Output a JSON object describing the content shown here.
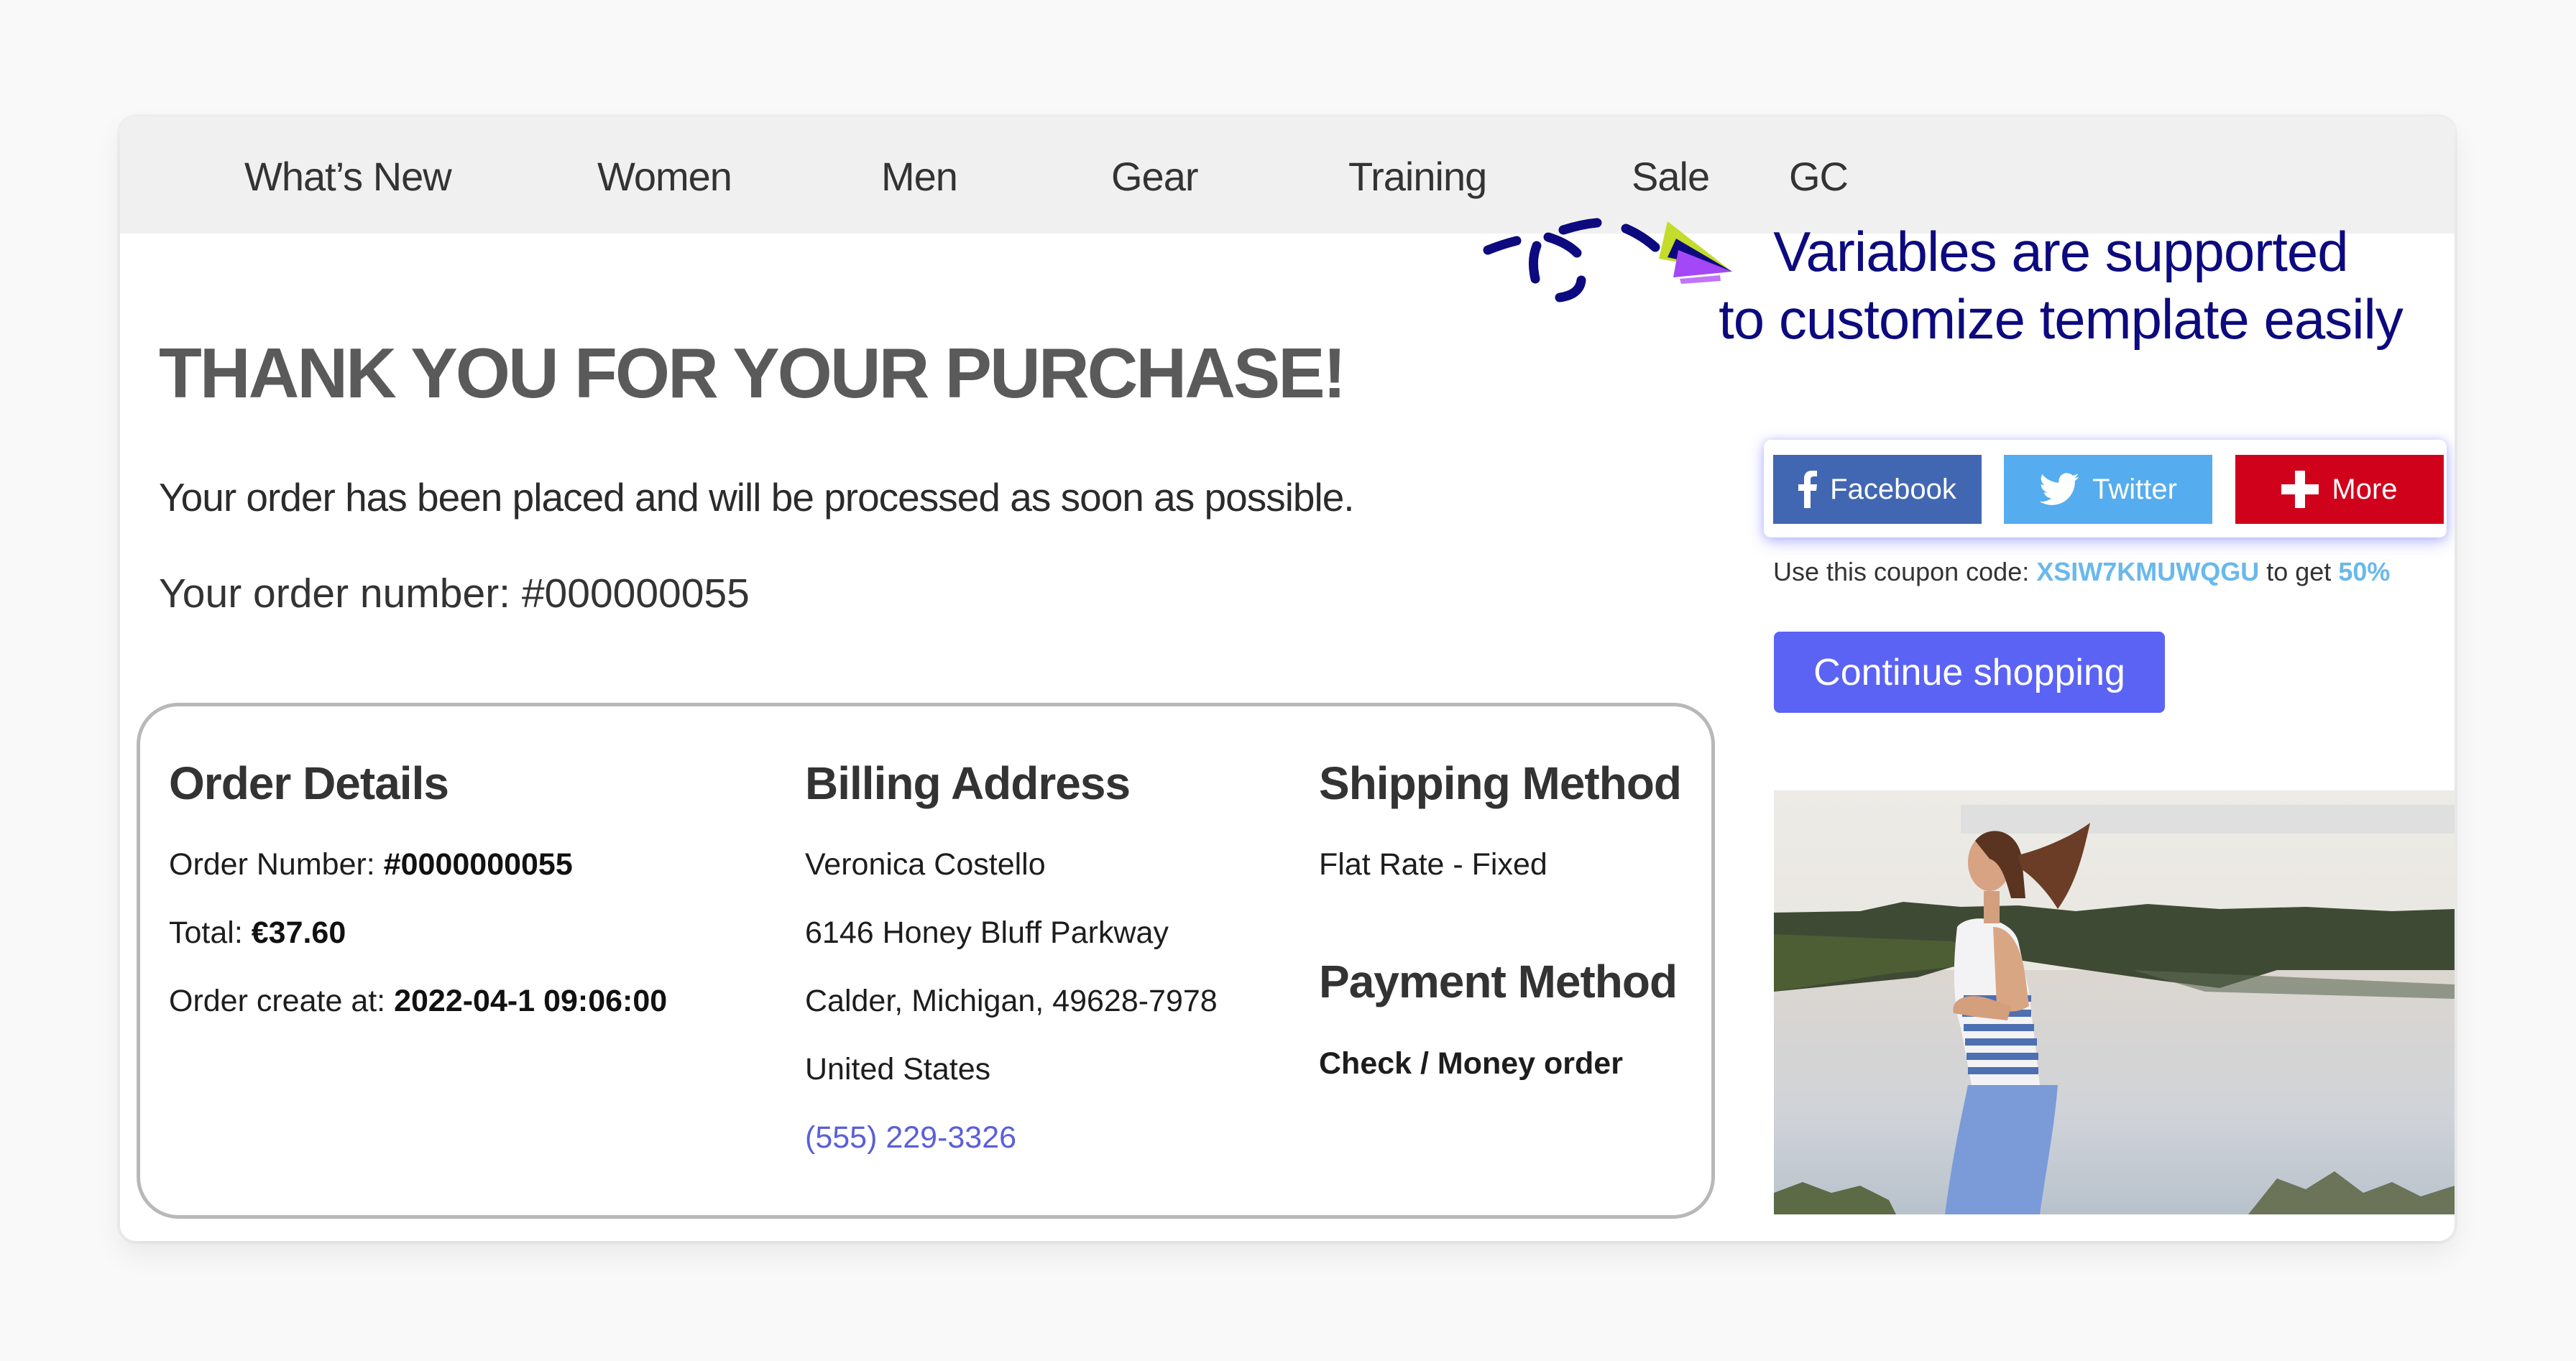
{
  "nav": {
    "items": [
      {
        "label": "What’s New"
      },
      {
        "label": "Women"
      },
      {
        "label": "Men"
      },
      {
        "label": "Gear"
      },
      {
        "label": "Training"
      },
      {
        "label": "Sale"
      },
      {
        "label": "GC"
      }
    ]
  },
  "main": {
    "title": "THANK YOU FOR YOUR PURCHASE!",
    "subtitle": "Your order has been placed and will be processed as soon as possible.",
    "order_number_line": "Your order number: #000000055"
  },
  "order_details": {
    "heading": "Order Details",
    "order_number_label": "Order Number: ",
    "order_number_value": "#0000000055",
    "total_label": "Total: ",
    "total_value": "€37.60",
    "created_label": "Order create at: ",
    "created_value": "2022-04-1 09:06:00"
  },
  "billing_address": {
    "heading": "Billing Address",
    "name": "Veronica Costello",
    "street": "6146 Honey Bluff Parkway",
    "city_line": "Calder, Michigan, 49628-7978",
    "country": "United States",
    "phone": "(555) 229-3326"
  },
  "shipping_method": {
    "heading": "Shipping Method",
    "value": "Flat Rate - Fixed"
  },
  "payment_method": {
    "heading": "Payment Method",
    "value": "Check / Money order"
  },
  "annotation": {
    "line1": "Variables are supported",
    "line2": "to customize template easily"
  },
  "social": {
    "facebook_label": "Facebook",
    "twitter_label": "Twitter",
    "more_label": "More",
    "icons": {
      "facebook": "facebook-icon",
      "twitter": "twitter-bird-icon",
      "more": "plus-icon"
    },
    "colors": {
      "facebook": "#4267b2",
      "twitter": "#55acee",
      "more": "#d0021b"
    }
  },
  "coupon": {
    "prefix": "Use this coupon code: ",
    "code": "XSIW7KMUWQGU",
    "middle": " to get ",
    "discount": "50%"
  },
  "continue_button": {
    "label": "Continue shopping",
    "color": "#5b63f5"
  },
  "hero_image": {
    "description": "Woman jogging beside a lake"
  }
}
